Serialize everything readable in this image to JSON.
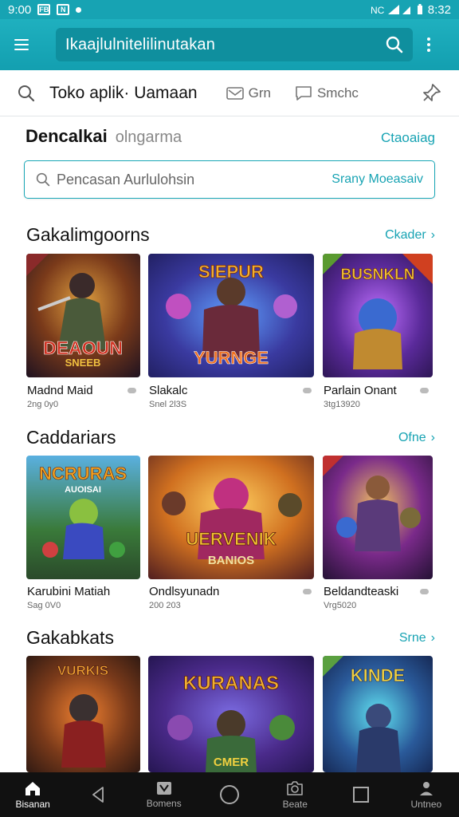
{
  "status_bar": {
    "time_left": "9:00",
    "time_right": "8:32",
    "box1": "FB",
    "box2": "N"
  },
  "app_bar": {
    "search_text": "Ikaajlulnitelilinutakan"
  },
  "sub_bar": {
    "title": "Toko aplik· Uamaan",
    "tab1": "Grn",
    "tab2": "Smchc"
  },
  "heading": {
    "title": "Dencalkai",
    "subtitle": "olngarma",
    "link": "Ctaoaiag"
  },
  "search_field": {
    "placeholder": "Pencasan Aurlulohsin",
    "hint": "Srany Moeasaiv"
  },
  "sections": [
    {
      "title": "Gakalimgoorns",
      "more": "Ckader",
      "cards": [
        {
          "title": "Madnd Maid",
          "sub": "2ng 0y0",
          "art": "DEAOUN",
          "art2": "SNEEB"
        },
        {
          "title": "Slakalc",
          "sub": "Snel 2l3S",
          "art": "SIEPUR",
          "art2": "YURNGE"
        },
        {
          "title": "Parlain Onant",
          "sub": "3tg13920",
          "art": "BUSNKLN",
          "art2": ""
        }
      ]
    },
    {
      "title": "Caddariars",
      "more": "Ofne",
      "cards": [
        {
          "title": "Karubini Matiah",
          "sub": "Sag 0V0",
          "art": "NCRURAS",
          "art2": "AUOISAI"
        },
        {
          "title": "Ondlsyunadn",
          "sub": "200 203",
          "art": "UERVENIK",
          "art2": "BANIOS"
        },
        {
          "title": "Beldandteaski",
          "sub": "Vrg5020",
          "art": "",
          "art2": ""
        }
      ]
    },
    {
      "title": "Gakabkats",
      "more": "Srne",
      "cards": [
        {
          "title": "",
          "sub": "",
          "art": "VURKIS",
          "art2": ""
        },
        {
          "title": "",
          "sub": "",
          "art": "KURANAS",
          "art2": "CMER"
        },
        {
          "title": "",
          "sub": "",
          "art": "KINDE",
          "art2": ""
        }
      ]
    }
  ],
  "nav": [
    {
      "label": "Bisanan",
      "icon": "home-icon"
    },
    {
      "label": "",
      "icon": "back-icon"
    },
    {
      "label": "Bomens",
      "icon": "games-icon"
    },
    {
      "label": "",
      "icon": "circle-home-icon"
    },
    {
      "label": "Beate",
      "icon": "camera-icon"
    },
    {
      "label": "",
      "icon": "recents-icon"
    },
    {
      "label": "Untneo",
      "icon": "profile-icon"
    }
  ],
  "colors": {
    "accent": "#17a3b3",
    "appbar": "#1fb0bf",
    "nav": "#111111"
  }
}
